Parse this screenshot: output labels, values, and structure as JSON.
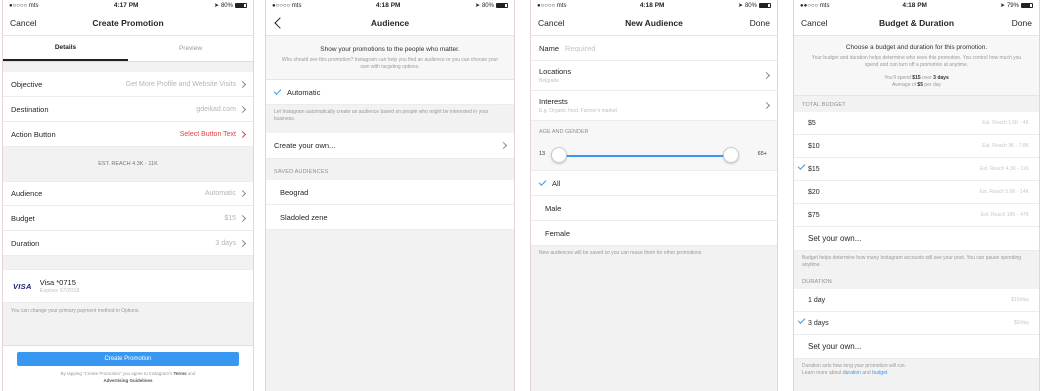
{
  "status": {
    "s1": {
      "carrier": "●○○○○ mts",
      "time": "4:17 PM",
      "battery": "80%"
    },
    "s2": {
      "carrier": "●○○○○ mts",
      "time": "4:18 PM",
      "battery": "80%"
    },
    "s3": {
      "carrier": "●○○○○ mts",
      "time": "4:18 PM",
      "battery": "80%"
    },
    "s4": {
      "carrier": "●●○○○ mts",
      "time": "4:18 PM",
      "battery": "79%"
    },
    "colors": {
      "accent": "#3897f0",
      "alert": "#e94040"
    }
  },
  "create": {
    "cancel": "Cancel",
    "title": "Create Promotion",
    "tabs": [
      "Details",
      "Preview"
    ],
    "objective": {
      "label": "Objective",
      "value": "Get More Profile and Website Visits"
    },
    "destination": {
      "label": "Destination",
      "value": "gdeikad.com"
    },
    "action": {
      "label": "Action Button",
      "value": "Select Button Text"
    },
    "reach": "EST. REACH 4.3K - 11K",
    "audience": {
      "label": "Audience",
      "value": "Automatic"
    },
    "budget": {
      "label": "Budget",
      "value": "$15"
    },
    "duration": {
      "label": "Duration",
      "value": "3 days"
    },
    "card": {
      "brand": "VISA",
      "number": "Visa *0715",
      "expires": "Expires 07/2018"
    },
    "payment_note": "You can change your primary payment method in Options.",
    "button": "Create Promotion",
    "legal_prefix": "By tapping \"Create Promotion\" you agree to Instagram's",
    "legal_terms": "Terms",
    "legal_and": "and",
    "legal_guidelines": "Advertising Guidelines"
  },
  "audience": {
    "title": "Audience",
    "heading": "Show your promotions to the people who matter.",
    "sub": "Who should see this promotion? Instagram can help you find an audience or you can choose your own with targeting options.",
    "automatic": "Automatic",
    "automatic_desc": "Let Instagram automatically create an audience based on people who might be interested in your business.",
    "create_own": "Create your own...",
    "saved_header": "SAVED AUDIENCES",
    "saved": [
      "Beograd",
      "Sladoled zene"
    ]
  },
  "new_audience": {
    "cancel": "Cancel",
    "title": "New Audience",
    "done": "Done",
    "name_label": "Name",
    "name_placeholder": "Required",
    "locations": {
      "label": "Locations",
      "value": "Belgrade"
    },
    "interests": {
      "label": "Interests",
      "placeholder": "E.g. Organic food, Farmer's market"
    },
    "age_header": "AGE AND GENDER",
    "age_min": "13",
    "age_max": "65+",
    "genders": [
      "All",
      "Male",
      "Female"
    ],
    "note": "New audiences will be saved so you can reuse them for other promotions."
  },
  "budget": {
    "cancel": "Cancel",
    "title": "Budget & Duration",
    "done": "Done",
    "heading": "Choose a budget and duration for this promotion.",
    "sub": "Your budget and duration helps determine who sees this promotion. You control how much you spend and can turn off a promotion at anytime.",
    "spend_prefix": "You'll spend",
    "spend_amount": "$15",
    "spend_over": "over",
    "spend_days": "3 days",
    "avg_prefix": "Average of",
    "avg_amount": "$5",
    "avg_suffix": "per day",
    "total_header": "TOTAL BUDGET",
    "options": [
      {
        "amount": "$5",
        "reach": "Est. Reach 1.5K - 4K"
      },
      {
        "amount": "$10",
        "reach": "Est. Reach 3K - 7.8K"
      },
      {
        "amount": "$15",
        "reach": "Est. Reach 4.3K - 11K"
      },
      {
        "amount": "$20",
        "reach": "Est. Reach 5.5K - 14K"
      },
      {
        "amount": "$75",
        "reach": "Est. Reach 18K - 47K"
      }
    ],
    "set_own": "Set your own...",
    "budget_note": "Budget helps determine how many Instagram accounts will see your post. You can pause spending anytime.",
    "duration_header": "DURATION",
    "durations": [
      {
        "label": "1 day",
        "rate": "$15/day"
      },
      {
        "label": "3 days",
        "rate": "$5/day"
      }
    ],
    "set_own_duration": "Set your own...",
    "duration_note": "Duration sets how long your promotion will run.",
    "learn_prefix": "Learn more about",
    "learn_duration": "duration",
    "learn_and": "and",
    "learn_budget": "budget"
  }
}
